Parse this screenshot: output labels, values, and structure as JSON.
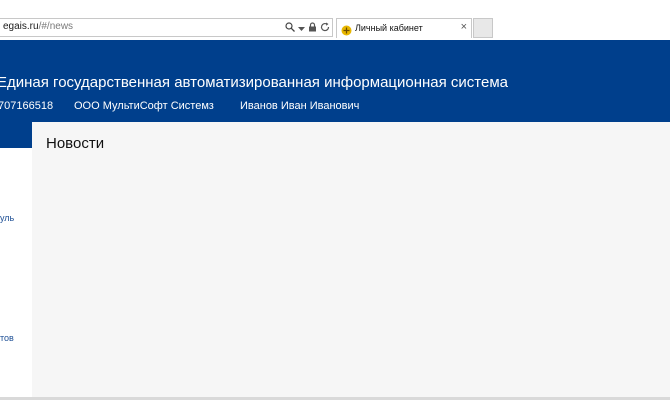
{
  "browser": {
    "address": {
      "host": "egais.ru",
      "path": "/#/news"
    },
    "tab": {
      "title": "Личный кабинет",
      "close": "×"
    }
  },
  "header": {
    "title": "Единая государственная автоматизированная информационная система",
    "inn": "707166518",
    "organization": "ООО МультиСофт Системз",
    "user": "Иванов Иван Иванович"
  },
  "sidebar": {
    "items": [
      {
        "label": "уль"
      },
      {
        "label": "тов"
      }
    ]
  },
  "main": {
    "title": "Новости"
  },
  "colors": {
    "header_bg": "#003f8c",
    "main_bg": "#f6f6f6",
    "link": "#1d4f95"
  }
}
